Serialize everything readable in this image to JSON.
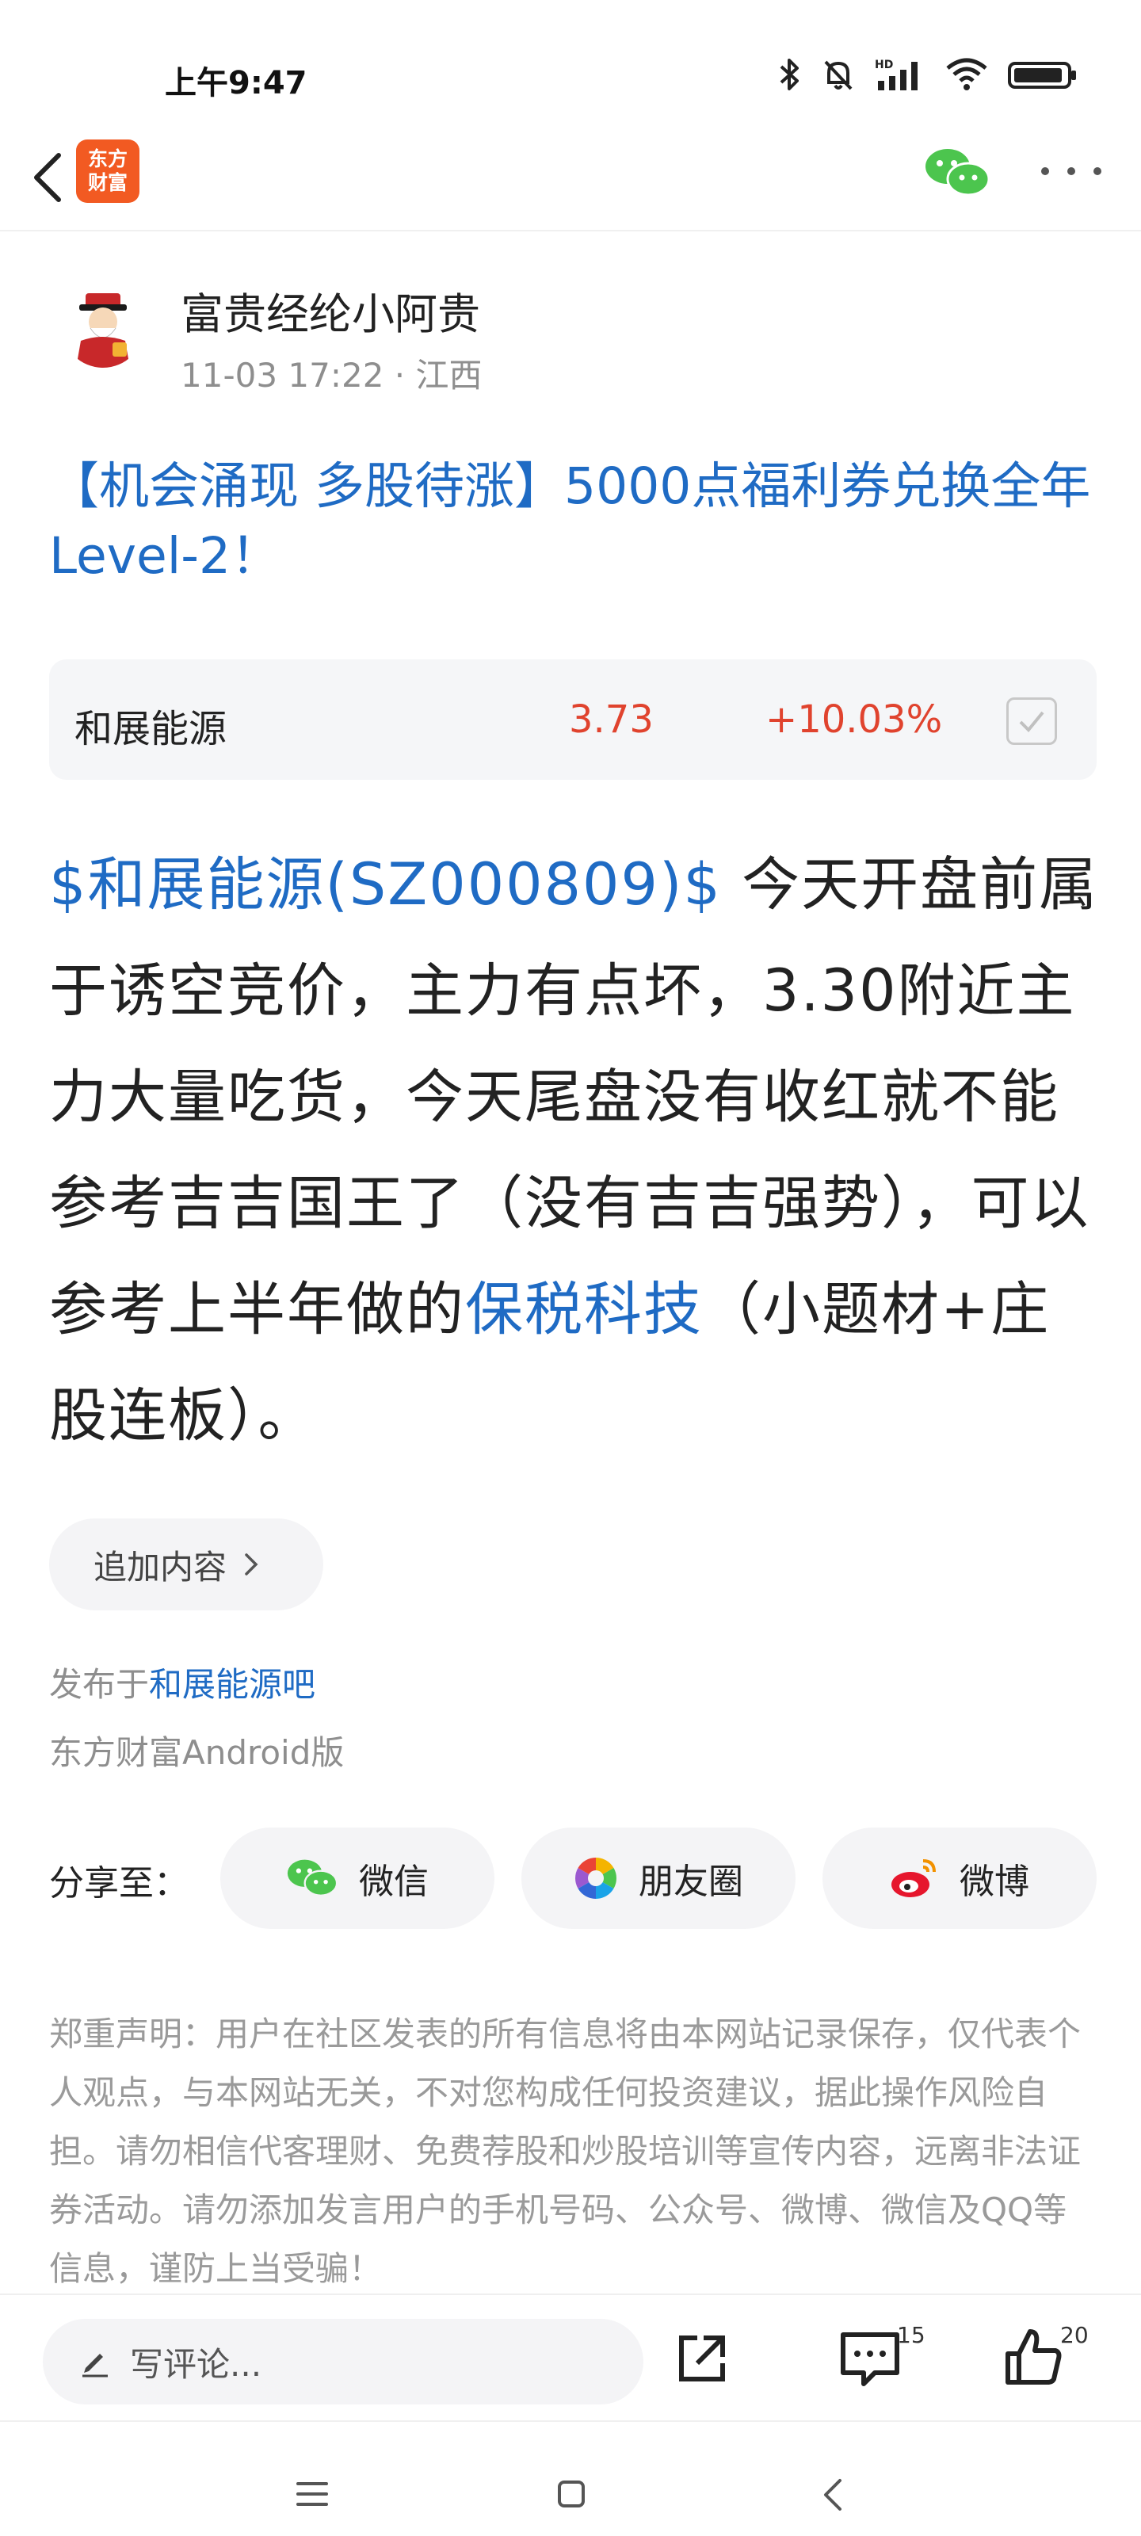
{
  "status_bar": {
    "time": "上午9:47"
  },
  "nav": {
    "app_logo_line1": "东方",
    "app_logo_line2": "财富"
  },
  "author": {
    "name": "富贵经纶小阿贵",
    "meta": "11-03 17:22 · 江西"
  },
  "post": {
    "title": "【机会涌现 多股待涨】5000点福利券兑换全年Level-2！",
    "body_stock_tag": "$和展能源(SZ000809)$",
    "body_text_1": " 今天开盘前属于诱空竞价，主力有点坏，3.30附近主力大量吃货，今天尾盘没有收红就不能参考吉吉国王了（没有吉吉强势），可以参考上半年做的",
    "body_link": "保税科技",
    "body_text_2": "（小题材+庄股连板）。"
  },
  "stock_card": {
    "name": "和展能源",
    "price": "3.73",
    "change": "+10.03%"
  },
  "append": {
    "label": "追加内容"
  },
  "footer_meta": {
    "published_prefix": "发布于",
    "forum": "和展能源吧",
    "client": "东方财富Android版"
  },
  "share": {
    "label": "分享至：",
    "wechat": "微信",
    "moments": "朋友圈",
    "weibo": "微博"
  },
  "disclaimer": "郑重声明：用户在社区发表的所有信息将由本网站记录保存，仅代表个人观点，与本网站无关，不对您构成任何投资建议，据此操作风险自担。请勿相信代客理财、免费荐股和炒股培训等宣传内容，远离非法证券活动。请勿添加发言用户的手机号码、公众号、微博、微信及QQ等信息，谨防上当受骗！",
  "bottom_bar": {
    "comment_placeholder": "写评论...",
    "comment_count": "15",
    "like_count": "20"
  },
  "colors": {
    "link_blue": "#1f6bc4",
    "up_red": "#e0432e",
    "brand_orange": "#f25a22",
    "wechat_green": "#4cc54e"
  }
}
